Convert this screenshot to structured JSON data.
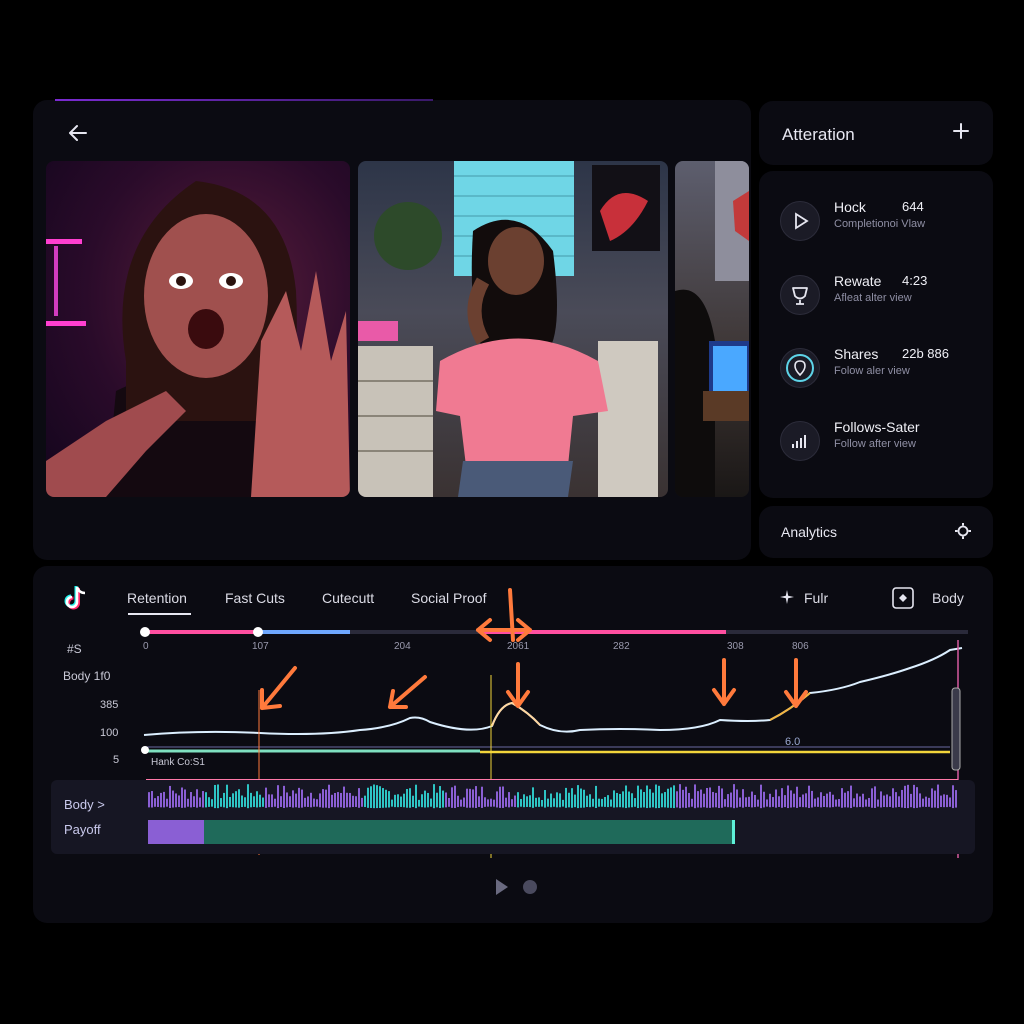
{
  "header": {
    "back_icon": "arrow-left-icon"
  },
  "right_panel": {
    "title": "Atteration",
    "metrics": [
      {
        "title": "Hock",
        "value": "644",
        "sub": "Completionoi Vlaw",
        "icon": "play-icon"
      },
      {
        "title": "Rewate",
        "value": "4:23",
        "sub": "Afleat alter view",
        "icon": "trophy-icon"
      },
      {
        "title": "Shares",
        "value": "22b 886",
        "sub": "Folow aler view",
        "icon": "location-pin-icon"
      },
      {
        "title": "Follows-Sater",
        "value": "",
        "sub": "Follow after view",
        "icon": "bar-chart-icon"
      }
    ],
    "analytics_label": "Analytics"
  },
  "timeline": {
    "tabs": [
      "Retention",
      "Fast Cuts",
      "Cutecutt",
      "Social Proof"
    ],
    "active_tab": "Retention",
    "right_tools": {
      "full_label": "Fulr",
      "body_label": "Body"
    },
    "tick_labels": [
      "0",
      "107",
      "204",
      "2061",
      "282",
      "308",
      "806"
    ],
    "y_labels": [
      "#S",
      "Body 1f0",
      "385",
      "100",
      "5"
    ],
    "marker_label": "Hank  Co:S1",
    "value_label": "6.0",
    "track_labels": [
      "Body >",
      "Payoff"
    ]
  },
  "colors": {
    "accent_pink": "#ff4fa0",
    "accent_blue": "#6fa8ff",
    "accent_yellow": "#f2d43b",
    "arrow_orange": "#ff7a3c",
    "teal": "#2ec4c4",
    "purple": "#8a5fd4"
  }
}
